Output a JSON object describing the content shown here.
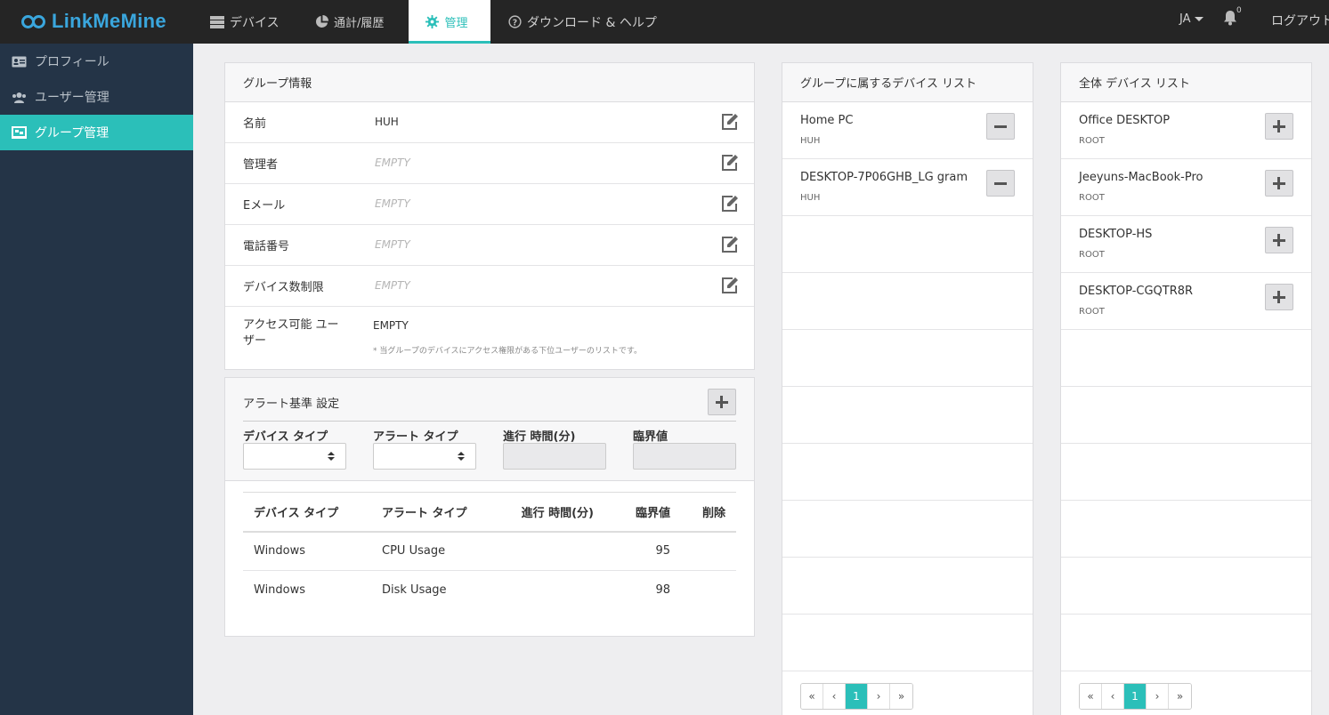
{
  "app": {
    "logo_text": "LinkMeMine"
  },
  "nav": {
    "tabs": [
      {
        "label": "デバイス",
        "icon": "server-icon"
      },
      {
        "label": "通計/履歴",
        "icon": "pie-chart-icon"
      },
      {
        "label": "管理",
        "icon": "gear-icon",
        "active": true
      },
      {
        "label": "ダウンロード & ヘルプ",
        "icon": "help-circle-icon"
      }
    ],
    "language": "JA",
    "notification_count": "0",
    "logout_label": "ログアウト"
  },
  "sidebar": {
    "items": [
      {
        "label": "プロフィール",
        "icon": "id-card-icon"
      },
      {
        "label": "ユーザー管理",
        "icon": "users-icon"
      },
      {
        "label": "グループ管理",
        "icon": "group-icon",
        "active": true
      }
    ]
  },
  "group_info": {
    "title": "グループ情報",
    "rows": [
      {
        "label": "名前",
        "value": "HUH",
        "empty": false
      },
      {
        "label": "管理者",
        "value": "EMPTY",
        "empty": true
      },
      {
        "label": "Eメール",
        "value": "EMPTY",
        "empty": true
      },
      {
        "label": "電話番号",
        "value": "EMPTY",
        "empty": true
      },
      {
        "label": "デバイス数制限",
        "value": "EMPTY",
        "empty": true
      }
    ],
    "access": {
      "label": "アクセス可能 ユーザー",
      "value": "EMPTY",
      "note": "* 当グループのデバイスにアクセス権限がある下位ユーザーのリストです。"
    }
  },
  "alert_settings": {
    "title": "アラート基準 設定",
    "filters": {
      "device_type_label": "デバイス タイプ",
      "alert_type_label": "アラート タイプ",
      "duration_label": "進行 時間(分)",
      "threshold_label": "臨界値"
    },
    "table": {
      "headers": [
        "デバイス タイプ",
        "アラート タイプ",
        "進行 時間(分)",
        "臨界値",
        "削除"
      ],
      "rows": [
        [
          "Windows",
          "CPU Usage",
          "",
          "95",
          ""
        ],
        [
          "Windows",
          "Disk Usage",
          "",
          "98",
          ""
        ]
      ]
    }
  },
  "group_devices": {
    "title": "グループに属するデバイス リスト",
    "items": [
      {
        "name": "Home PC",
        "group": "HUH"
      },
      {
        "name": "DESKTOP-7P06GHB_LG gram",
        "group": "HUH"
      }
    ],
    "pagination": [
      "«",
      "‹",
      "1",
      "›",
      "»"
    ],
    "current_page": "1"
  },
  "all_devices": {
    "title": "全体 デバイス リスト",
    "items": [
      {
        "name": "Office DESKTOP",
        "group": "ROOT"
      },
      {
        "name": "Jeeyuns-MacBook-Pro",
        "group": "ROOT"
      },
      {
        "name": "DESKTOP-HS",
        "group": "ROOT"
      },
      {
        "name": "DESKTOP-CGQTR8R",
        "group": "ROOT"
      }
    ],
    "pagination": [
      "«",
      "‹",
      "1",
      "›",
      "»"
    ],
    "current_page": "1"
  },
  "colors": {
    "accent": "#2bbfb9",
    "topbar": "#252525",
    "sidebar": "#243447",
    "logo": "#3aa6dd"
  }
}
